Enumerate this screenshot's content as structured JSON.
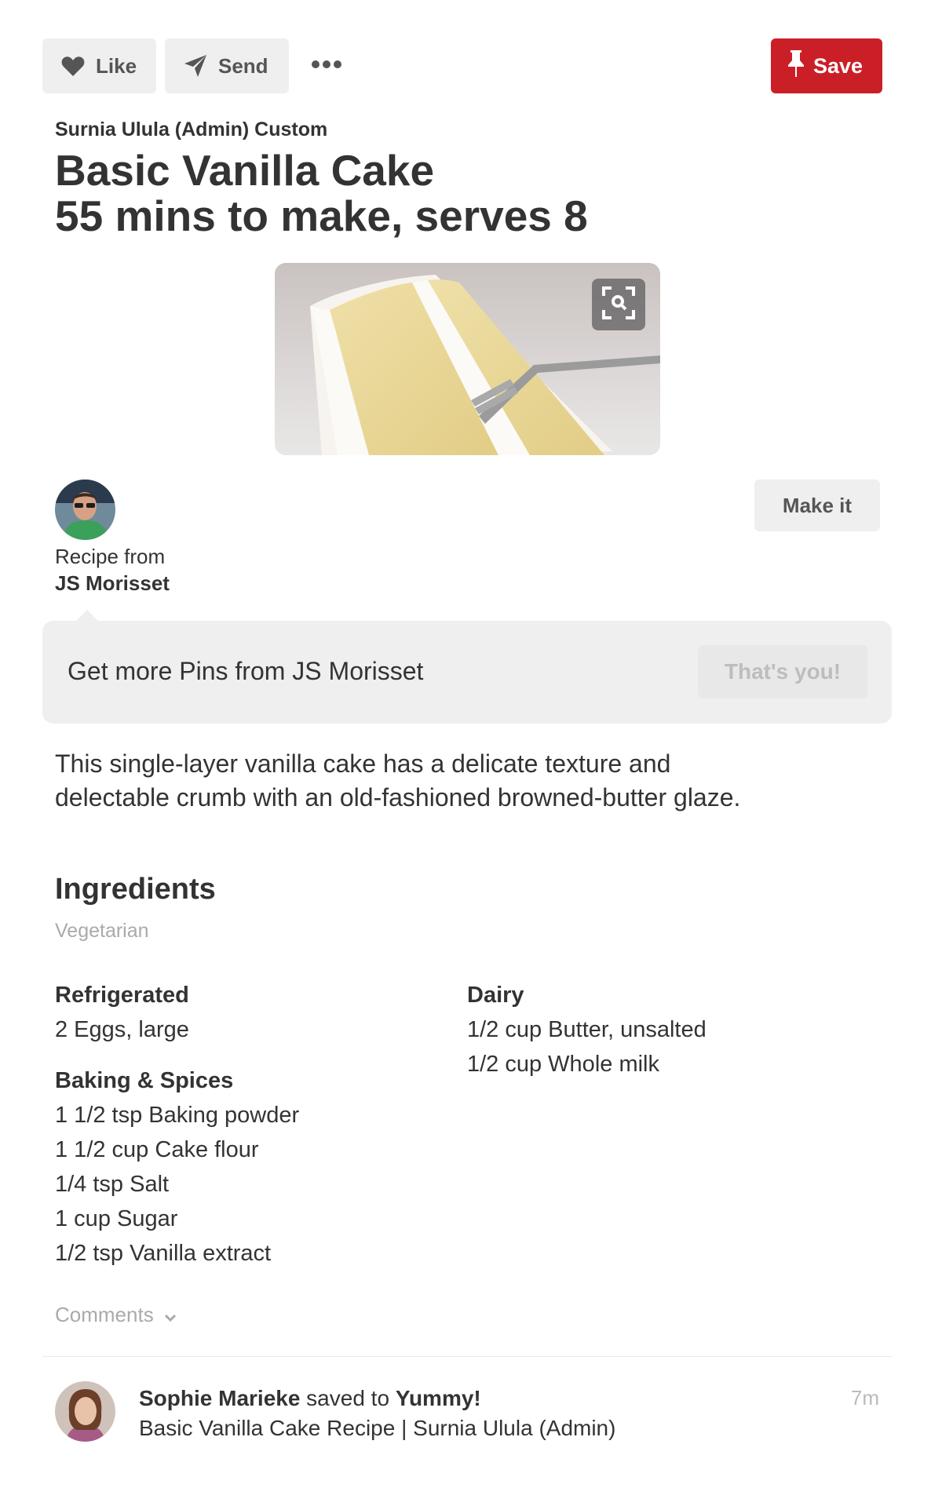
{
  "actions": {
    "like_label": "Like",
    "send_label": "Send",
    "save_label": "Save",
    "accent_color": "#cb1f27"
  },
  "pin": {
    "board": "Surnia Ulula (Admin) Custom",
    "title_line1": "Basic Vanilla Cake",
    "title_line2": "55 mins to make, serves 8",
    "image_icon": "visual-search-icon"
  },
  "source": {
    "recipe_from_label": "Recipe from",
    "author": "JS Morisset",
    "make_it_label": "Make it"
  },
  "more_pins": {
    "text": "Get more Pins from JS Morisset",
    "button_label": "That's you!"
  },
  "description": "This single-layer vanilla cake has a delicate texture and delectable crumb with an old-fashioned browned-butter glaze.",
  "ingredients": {
    "title": "Ingredients",
    "tag": "Vegetarian",
    "left": [
      {
        "category": "Refrigerated",
        "items": [
          "2 Eggs, large"
        ]
      },
      {
        "category": "Baking & Spices",
        "items": [
          "1 1/2 tsp Baking powder",
          "1 1/2 cup Cake flour",
          "1/4 tsp Salt",
          "1 cup Sugar",
          "1/2 tsp Vanilla extract"
        ]
      }
    ],
    "right": [
      {
        "category": "Dairy",
        "items": [
          "1/2 cup Butter, unsalted",
          "1/2 cup Whole milk"
        ]
      }
    ]
  },
  "comments_label": "Comments",
  "activity": {
    "user": "Sophie Marieke",
    "verb": " saved to ",
    "board": "Yummy!",
    "pin_title": "Basic Vanilla Cake Recipe | Surnia Ulula (Admin)",
    "time": "7m"
  }
}
